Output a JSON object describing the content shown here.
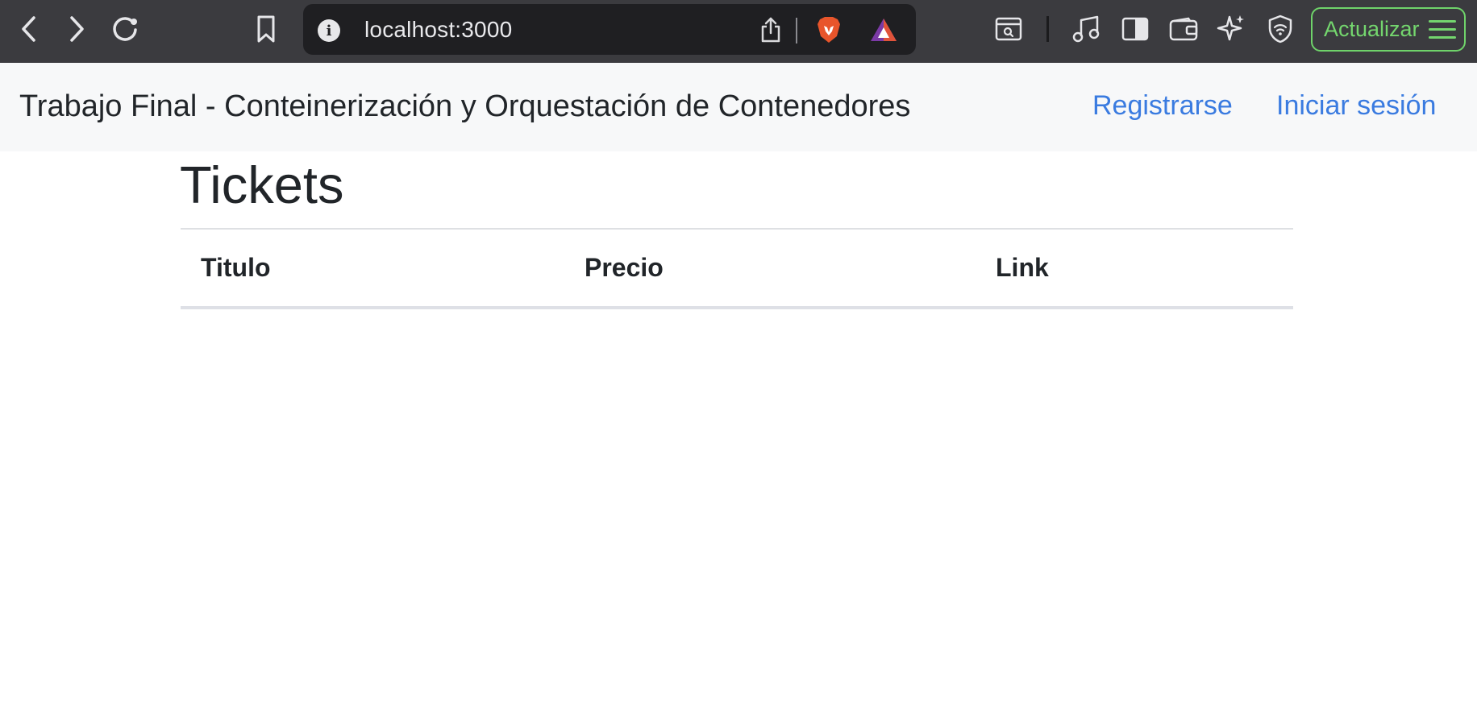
{
  "browser": {
    "url": "localhost:3000",
    "update_label": "Actualizar",
    "colors": {
      "chrome_bg": "#3b3b3f",
      "urlbar_bg": "#1f1f22",
      "update_accent": "#74d66e",
      "brave_orange": "#e8552b"
    },
    "icons": [
      "back-icon",
      "forward-icon",
      "reload-icon",
      "bookmark-icon",
      "info-icon",
      "share-icon",
      "brave-shields-icon",
      "brave-rewards-icon",
      "tab-search-icon",
      "music-icon",
      "sidebar-icon",
      "wallet-icon",
      "leo-ai-icon",
      "vpn-icon",
      "menu-icon"
    ]
  },
  "navbar": {
    "brand": "Trabajo Final - Conteinerización y Orquestación de Contenedores",
    "links": [
      "Registrarse",
      "Iniciar sesión"
    ],
    "link_color": "#3a7be0"
  },
  "main": {
    "title": "Tickets",
    "table": {
      "columns": [
        "Titulo",
        "Precio",
        "Link"
      ],
      "rows": []
    }
  }
}
